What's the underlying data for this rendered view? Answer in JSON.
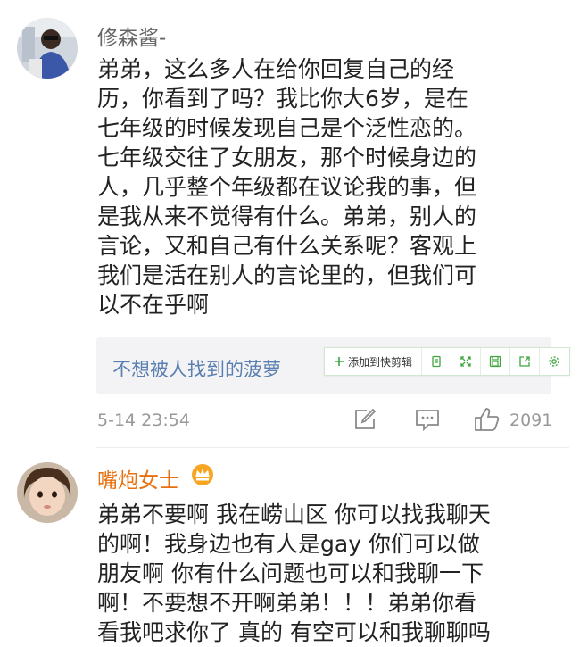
{
  "comments": [
    {
      "username": "修森酱-",
      "lines": [
        "弟弟，这么多人在给你回复自己的经",
        "历，你看到了吗？我比你大6岁，是在",
        "七年级的时候发现自己是个泛性恋的。",
        "七年级交往了女朋友，那个时候身边的",
        "人，几乎整个年级都在议论我的事，但",
        "是我从来不觉得有什么。弟弟，别人的",
        "言论，又和自己有什么关系呢？客观上",
        "我们是活在别人的言论里的，但我们可",
        "以不在乎啊"
      ],
      "reply_preview": "不想被人找到的菠萝",
      "timestamp": "5-14 23:54",
      "likes": "2091"
    },
    {
      "username": "嘴炮女士",
      "lines": [
        "弟弟不要啊 我在崂山区 你可以找我聊天",
        "的啊！我身边也有人是gay 你们可以做",
        "朋友啊 你有什么问题也可以和我聊一下",
        "啊！不要想不开啊弟弟！！！弟弟你看",
        "看我吧求你了 真的 有空可以和我聊聊吗"
      ]
    }
  ],
  "clip_toolbar": {
    "add_label": "添加到快剪辑",
    "accent": "#3fa63f"
  },
  "colors": {
    "username": "#666666",
    "vip_username": "#e8700e",
    "reply_link": "#5a7fb0",
    "meta": "#999999"
  }
}
